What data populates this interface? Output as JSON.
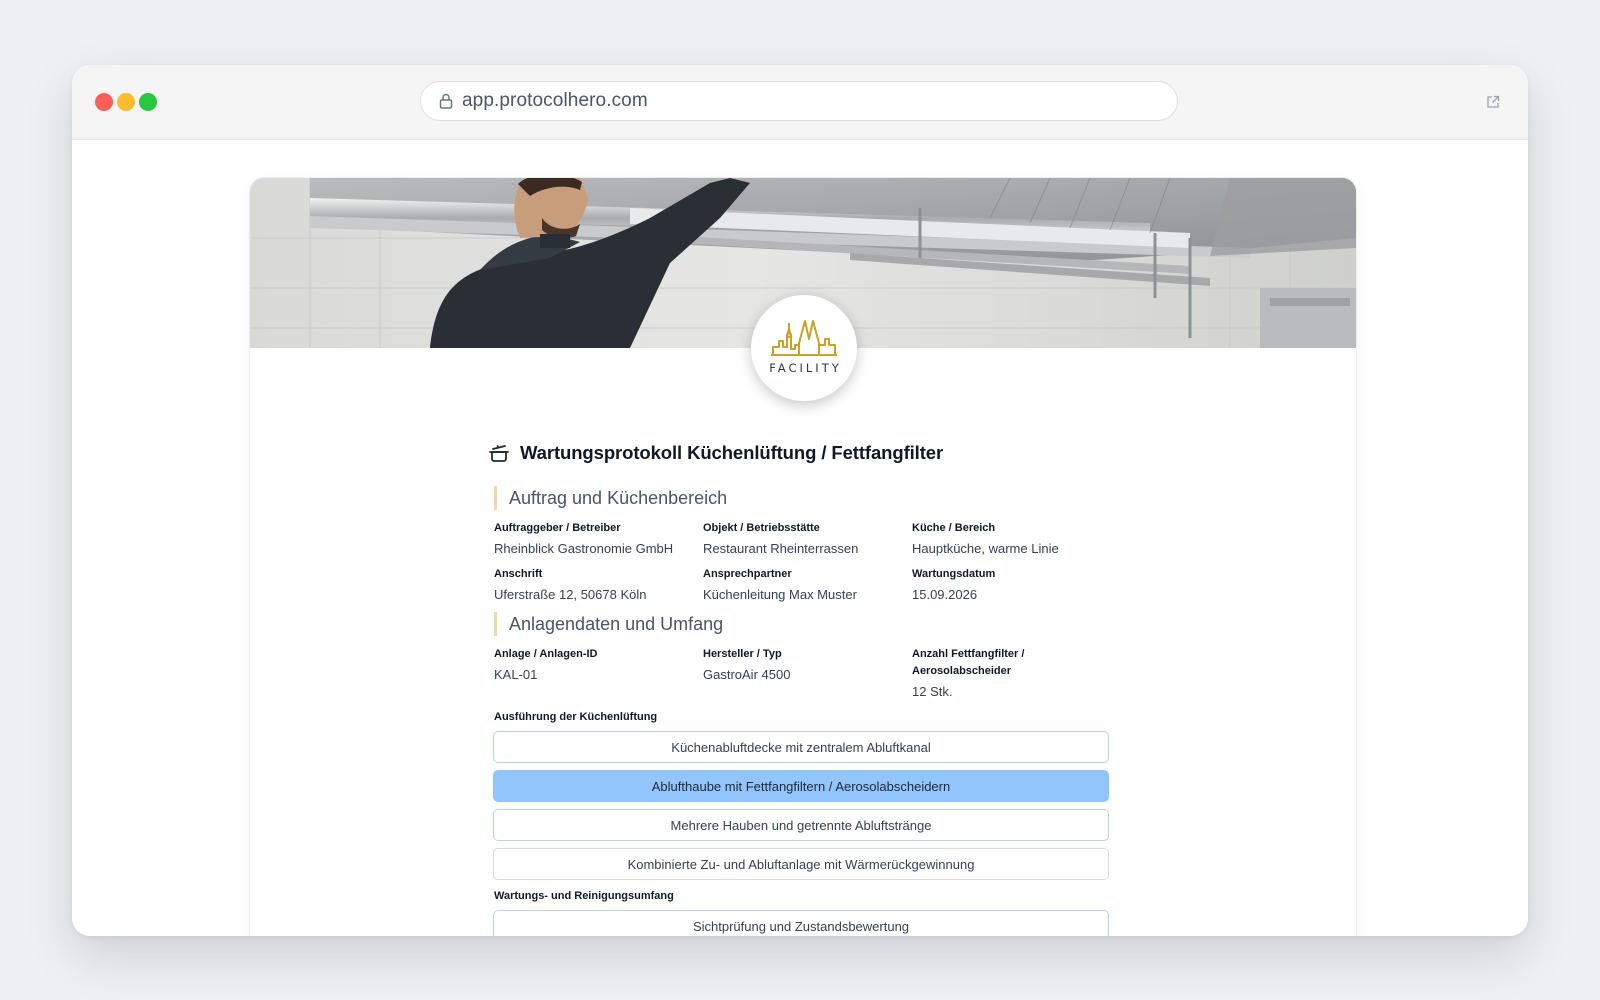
{
  "browser": {
    "url": "app.protocolhero.com"
  },
  "logo": {
    "text": "FACILITY"
  },
  "form": {
    "title": "Wartungsprotokoll Küchenlüftung / Fettfangfilter",
    "sections": [
      {
        "heading": "Auftrag und Küchenbereich",
        "fields": [
          {
            "label": "Auftraggeber / Betreiber",
            "value": "Rheinblick Gastronomie GmbH"
          },
          {
            "label": "Objekt / Betriebsstätte",
            "value": "Restaurant Rheinterrassen"
          },
          {
            "label": "Küche / Bereich",
            "value": "Hauptküche, warme Linie"
          },
          {
            "label": "Anschrift",
            "value": "Uferstraße 12, 50678 Köln"
          },
          {
            "label": "Ansprechpartner",
            "value": "Küchenleitung Max Muster"
          },
          {
            "label": "Wartungsdatum",
            "value": "15.09.2026"
          }
        ]
      },
      {
        "heading": "Anlagendaten und Umfang",
        "fields": [
          {
            "label": "Anlage / Anlagen-ID",
            "value": "KAL-01"
          },
          {
            "label": "Hersteller / Typ",
            "value": "GastroAir 4500"
          },
          {
            "label": "Anzahl Fettfangfilter / Aerosolabscheider",
            "value": "12 Stk."
          }
        ]
      }
    ],
    "ausfuehrung": {
      "label": "Ausführung der Küchenlüftung",
      "selected_index": 1,
      "options": [
        "Küchenabluftdecke mit zentralem Abluftkanal",
        "Ablufthaube mit Fettfangfiltern / Aerosolabscheidern",
        "Mehrere Hauben und getrennte Abluftstränge",
        "Kombinierte Zu- und Abluftanlage mit Wärmerückgewinnung"
      ]
    },
    "umfang": {
      "label": "Wartungs- und Reinigungsumfang",
      "options": [
        "Sichtprüfung und Zustandsbewertung"
      ]
    }
  },
  "colors": {
    "accent_selected": "#93c5fd",
    "option_border": "#b8d4f0",
    "section_bar": "#f0d9a6",
    "logo_gold": "#c9a227"
  }
}
